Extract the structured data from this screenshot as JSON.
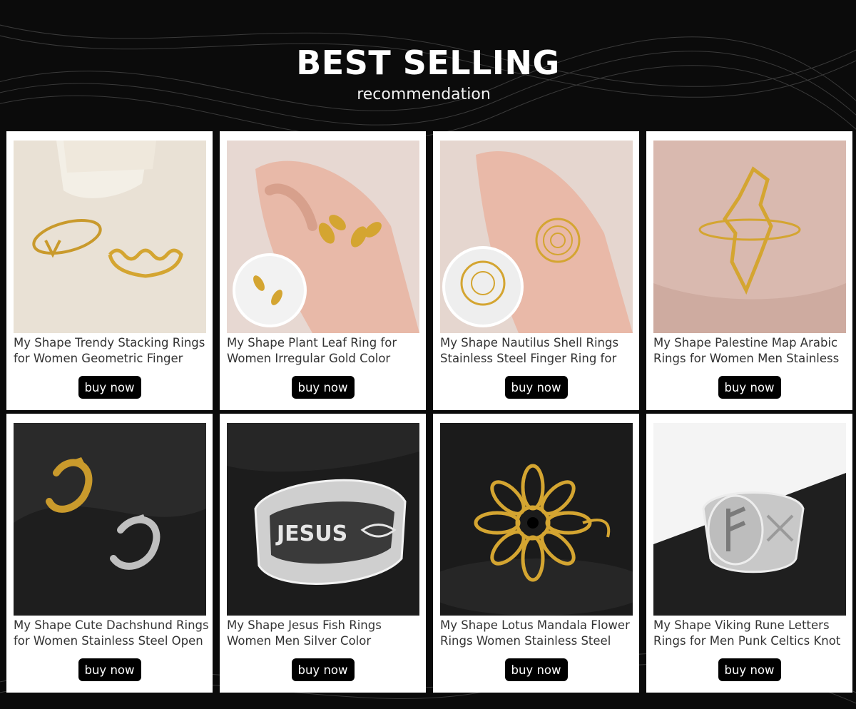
{
  "header": {
    "title": "BEST SELLING",
    "subtitle": "recommendation"
  },
  "buy_label": "buy now",
  "products": [
    {
      "name": "My Shape Trendy Stacking Rings for Women Geometric Finger",
      "image_desc": "gold stacking rings on beige",
      "image_icon": "ring-image"
    },
    {
      "name": "My Shape Plant Leaf Ring for Women Irregular Gold Color",
      "image_desc": "gold leaf ring on hand",
      "image_icon": "ring-image"
    },
    {
      "name": "My Shape Nautilus Shell Rings Stainless Steel Finger Ring for",
      "image_desc": "gold nautilus shell ring on hand",
      "image_icon": "ring-image"
    },
    {
      "name": "My Shape Palestine Map Arabic Rings for Women Men Stainless",
      "image_desc": "gold palestine map ring",
      "image_icon": "ring-image"
    },
    {
      "name": "My Shape Cute Dachshund Rings for Women Stainless Steel Open",
      "image_desc": "gold and silver dachshund rings",
      "image_icon": "ring-image"
    },
    {
      "name": "My Shape Jesus Fish Rings Women Men Silver Color",
      "image_desc": "silver jesus fish ring",
      "image_icon": "ring-image"
    },
    {
      "name": "My Shape Lotus Mandala Flower Rings Women Stainless Steel",
      "image_desc": "gold lotus mandala ring",
      "image_icon": "ring-image"
    },
    {
      "name": "My Shape Viking Rune Letters Rings for Men Punk Celtics Knot",
      "image_desc": "silver viking rune ring",
      "image_icon": "ring-image"
    }
  ],
  "colors": {
    "background": "#0b0b0b",
    "card": "#ffffff",
    "button": "#000000",
    "gold": "#d4a531",
    "silver": "#c8c8c8"
  }
}
